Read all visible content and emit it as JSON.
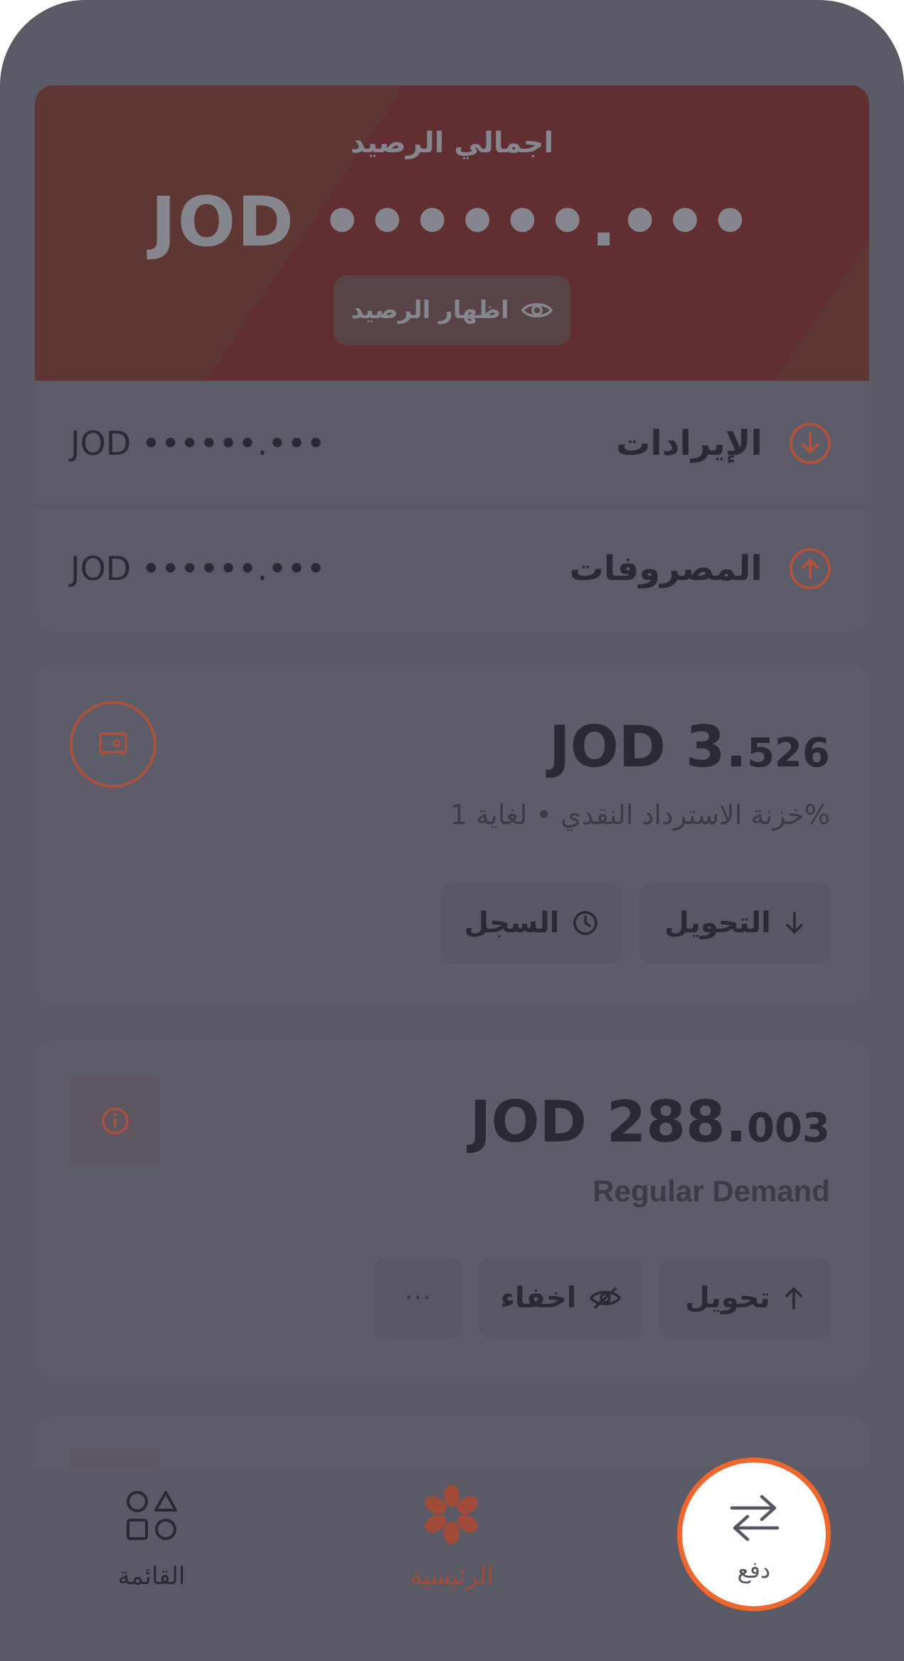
{
  "balance_card": {
    "title": "اجمالي الرصيد",
    "amount": "JOD ••••••.•••",
    "show_button_label": "اظهار الرصيد",
    "accent_color": "#5e3734"
  },
  "summary": {
    "income": {
      "label": "الإيرادات",
      "value": "JOD ••••••.•••",
      "icon": "arrow-down-circle-icon"
    },
    "expenses": {
      "label": "المصروفات",
      "value": "JOD ••••••.•••",
      "icon": "arrow-up-circle-icon"
    }
  },
  "cashback_vault": {
    "amount_whole": "JOD 3.",
    "amount_decimal": "526",
    "subtitle": "خزنة الاسترداد النقدي • لغاية 1%",
    "actions": [
      {
        "label": "التحويل",
        "icon": "arrow-down-icon"
      },
      {
        "label": "السجل",
        "icon": "clock-icon"
      }
    ],
    "icon": "safe-icon"
  },
  "regular_account": {
    "amount_whole": "JOD 288.",
    "amount_decimal": "003",
    "subtitle": "Regular Demand",
    "actions": [
      {
        "label": "تحويل",
        "icon": "arrow-up-icon"
      },
      {
        "label": "اخفاء",
        "icon": "eye-off-icon"
      },
      {
        "label": "···",
        "icon": "more-icon"
      }
    ],
    "icon": "info-icon"
  },
  "bottom_nav": {
    "pay": {
      "label": "دفع",
      "icon": "transfer-arrows-icon"
    },
    "home": {
      "label": "الرئيسية",
      "icon": "flower-logo-icon"
    },
    "menu": {
      "label": "القائمة",
      "icon": "shapes-grid-icon"
    }
  },
  "colors": {
    "accent": "#b1533c",
    "highlight_ring": "#f0672e",
    "overlay": "#5a5a66"
  }
}
